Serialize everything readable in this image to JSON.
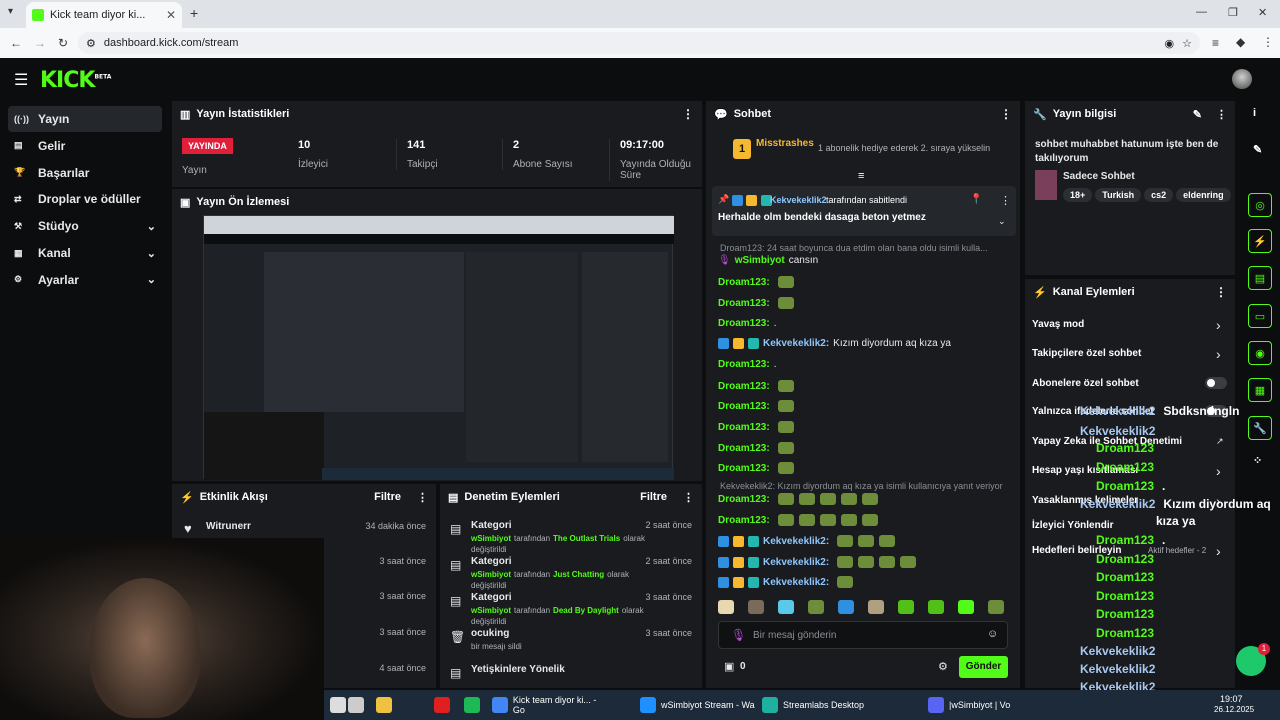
{
  "browser": {
    "tab_title": "Kick team diyor ki...",
    "url": "dashboard.kick.com/stream"
  },
  "brand": {
    "logo": "KICK",
    "beta": "BETA",
    "accent": "#53fc18"
  },
  "sidebar": {
    "items": [
      {
        "label": "Yayın",
        "icon": "broadcast-icon",
        "active": true
      },
      {
        "label": "Gelir",
        "icon": "wallet-icon"
      },
      {
        "label": "Başarılar",
        "icon": "trophy-icon"
      },
      {
        "label": "Droplar ve ödüller",
        "icon": "gift-icon"
      },
      {
        "label": "Stüdyo",
        "icon": "studio-icon",
        "expand": true
      },
      {
        "label": "Kanal",
        "icon": "channel-icon",
        "expand": true
      },
      {
        "label": "Ayarlar",
        "icon": "gear-icon",
        "expand": true
      }
    ]
  },
  "stats": {
    "title": "Yayın İstatistikleri",
    "live_badge": "YAYINDA",
    "live_label": "Yayın",
    "items": [
      {
        "value": "10",
        "label": "İzleyici"
      },
      {
        "value": "141",
        "label": "Takipçi"
      },
      {
        "value": "2",
        "label": "Abone Sayısı"
      },
      {
        "value": "09:17:00",
        "label": "Yayında Olduğu Süre"
      }
    ]
  },
  "preview": {
    "title": "Yayın Ön İzlemesi"
  },
  "activity": {
    "title": "Etkinlik Akışı",
    "filter": "Filtre",
    "items": [
      {
        "user": "Witrunerr",
        "time": "34 dakika önce"
      },
      {
        "time": "3 saat önce"
      },
      {
        "time": "3 saat önce"
      },
      {
        "time": "3 saat önce"
      },
      {
        "time": "4 saat önce"
      }
    ]
  },
  "moderation": {
    "title": "Denetim Eylemleri",
    "filter": "Filtre",
    "items": [
      {
        "title": "Kategori",
        "user": "wSimbiyot",
        "mid": "tarafından",
        "target": "The Outlast Trials",
        "tail": "olarak değiştirildi",
        "time": "2 saat önce"
      },
      {
        "title": "Kategori",
        "user": "wSimbiyot",
        "mid": "tarafından",
        "target": "Just Chatting",
        "tail": "olarak değiştirildi",
        "time": "2 saat önce"
      },
      {
        "title": "Kategori",
        "user": "wSimbiyot",
        "mid": "tarafından",
        "target": "Dead By Daylight",
        "tail": "olarak değiştirildi",
        "time": "3 saat önce"
      },
      {
        "title": "ocuking",
        "desc": "bir mesajı sildi",
        "time": "3 saat önce"
      },
      {
        "title": "Yetişkinlere Yönelik",
        "time": ""
      }
    ]
  },
  "chat": {
    "title": "Sohbet",
    "gift_user": "Misstrashes",
    "gift_rank": "1",
    "gift_text": "1 abonelik hediye ederek 2. sıraya yükselin",
    "pinned_by": "Kekvekeklik2",
    "pinned_suffix": "tarafından sabitlendi",
    "pinned_text": "Herhalde olm bendeki dasaga beton yetmez",
    "reply1": "Droam123: 24 saat boyunca dua etdim olan bana oldu",
    "reply1_tail": "isimli kulla...",
    "reply2": "Kekvekeklik2: Kızım diyordum aq kıza ya isimli kullanıcıya yanıt veriyor",
    "messages": [
      {
        "user": "wSimbiyot",
        "text": "cansın",
        "color": "green"
      },
      {
        "user": "Droam123:",
        "text": "",
        "color": "green"
      },
      {
        "user": "Droam123:",
        "text": "",
        "color": "green"
      },
      {
        "user": "Droam123:",
        "text": ".",
        "color": "green"
      },
      {
        "user": "Kekvekeklik2:",
        "text": "Kızım diyordum aq kıza ya",
        "color": "blue"
      },
      {
        "user": "Droam123:",
        "text": ".",
        "color": "green"
      },
      {
        "user": "Droam123:",
        "text": "",
        "color": "green"
      },
      {
        "user": "Droam123:",
        "text": "",
        "color": "green"
      },
      {
        "user": "Droam123:",
        "text": "",
        "color": "green"
      },
      {
        "user": "Droam123:",
        "text": "",
        "color": "green"
      },
      {
        "user": "Droam123:",
        "text": "",
        "color": "green"
      },
      {
        "user": "Droam123:",
        "text": "",
        "color": "green"
      },
      {
        "user": "Droam123:",
        "text": "",
        "color": "green"
      },
      {
        "user": "Kekvekeklik2:",
        "text": "",
        "color": "blue"
      },
      {
        "user": "Kekvekeklik2:",
        "text": "",
        "color": "blue"
      },
      {
        "user": "Kekvekeklik2:",
        "text": "",
        "color": "blue"
      }
    ],
    "input_placeholder": "Bir mesaj gönderin",
    "points": "0",
    "send_label": "Gönder"
  },
  "stream_info": {
    "title": "Yayın bilgisi",
    "stream_title": "sohbet muhabbet hatunum işte ben de takılıyorum",
    "category": "Sadece Sohbet",
    "tags": [
      "18+",
      "Turkish",
      "cs2",
      "eldenring"
    ]
  },
  "channel_actions": {
    "title": "Kanal Eylemleri",
    "items": [
      {
        "label": "Yavaş mod",
        "control": "arrow"
      },
      {
        "label": "Takipçilere özel sohbet",
        "control": "arrow"
      },
      {
        "label": "Abonelere özel sohbet",
        "control": "toggle"
      },
      {
        "label": "Yalnızca ifadelerle sohbet",
        "control": "toggle"
      },
      {
        "label": "Yapay Zeka ile Sohbet Denetimi",
        "control": "link"
      },
      {
        "label": "Hesap yaşı kısıtlaması",
        "control": "arrow"
      },
      {
        "label": "Yasaklanmış kelimeler",
        "control": "arrow"
      },
      {
        "label": "İzleyici Yönlendir",
        "control": "none"
      },
      {
        "label": "Hedefleri belirleyin",
        "control": "arrow",
        "note": "Aktif hedefler - 2"
      }
    ]
  },
  "overlay_chat": {
    "lines": [
      {
        "user": "Kekvekeklik2",
        "text": "Sbdksndngln"
      },
      {
        "user": "Kekvekeklik2",
        "text": ""
      },
      {
        "user": "Droam123",
        "text": ""
      },
      {
        "user": "Droam123",
        "text": ""
      },
      {
        "user": "Droam123",
        "text": "."
      },
      {
        "user": "Kekvekeklik2",
        "text": "Kızım diyordum aq"
      },
      {
        "user": "",
        "text": "kıza ya"
      },
      {
        "user": "Droam123",
        "text": "."
      },
      {
        "user": "Droam123",
        "text": ""
      },
      {
        "user": "Droam123",
        "text": ""
      },
      {
        "user": "Droam123",
        "text": ""
      },
      {
        "user": "Droam123",
        "text": ""
      },
      {
        "user": "Droam123",
        "text": ""
      },
      {
        "user": "Kekvekeklik2",
        "text": ""
      },
      {
        "user": "Kekvekeklik2",
        "text": ""
      },
      {
        "user": "Kekvekeklik2",
        "text": ""
      }
    ]
  },
  "taskbar": {
    "items": [
      {
        "label": "Kick team diyor ki... - Go"
      },
      {
        "label": "wSimbiyot Stream - Wa"
      },
      {
        "label": "Streamlabs Desktop"
      },
      {
        "label": "|wSimbiyot | Vo"
      }
    ],
    "time": "19:07",
    "date": "26.12.2025"
  },
  "notification_count": "1"
}
